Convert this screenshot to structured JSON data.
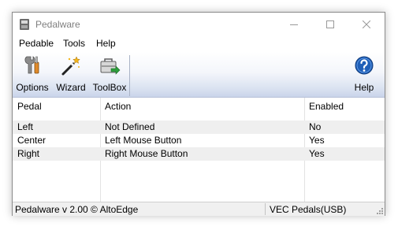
{
  "window": {
    "title": "Pedalware"
  },
  "menu": {
    "items": [
      "Pedable",
      "Tools",
      "Help"
    ]
  },
  "toolbar": {
    "options_label": "Options",
    "wizard_label": "Wizard",
    "toolbox_label": "ToolBox",
    "help_label": "Help"
  },
  "table": {
    "headers": [
      "Pedal",
      "Action",
      "Enabled"
    ],
    "rows": [
      {
        "pedal": "Left",
        "action": "Not Defined",
        "enabled": "No"
      },
      {
        "pedal": "Center",
        "action": "Left Mouse Button",
        "enabled": "Yes"
      },
      {
        "pedal": "Right",
        "action": "Right Mouse Button",
        "enabled": "Yes"
      }
    ]
  },
  "status": {
    "left": "Pedalware v 2.00 © AltoEdge",
    "right": "VEC Pedals(USB)"
  },
  "colors": {
    "toolbar_gradient_end": "#c9d4ea",
    "help_icon": "#1f5fb8",
    "alt_row": "#efefef"
  },
  "icons": {
    "app": "pedal-app-icon",
    "options": "wrench-options-icon",
    "wizard": "magic-wand-icon",
    "toolbox": "toolbox-icon",
    "help": "help-question-icon"
  }
}
